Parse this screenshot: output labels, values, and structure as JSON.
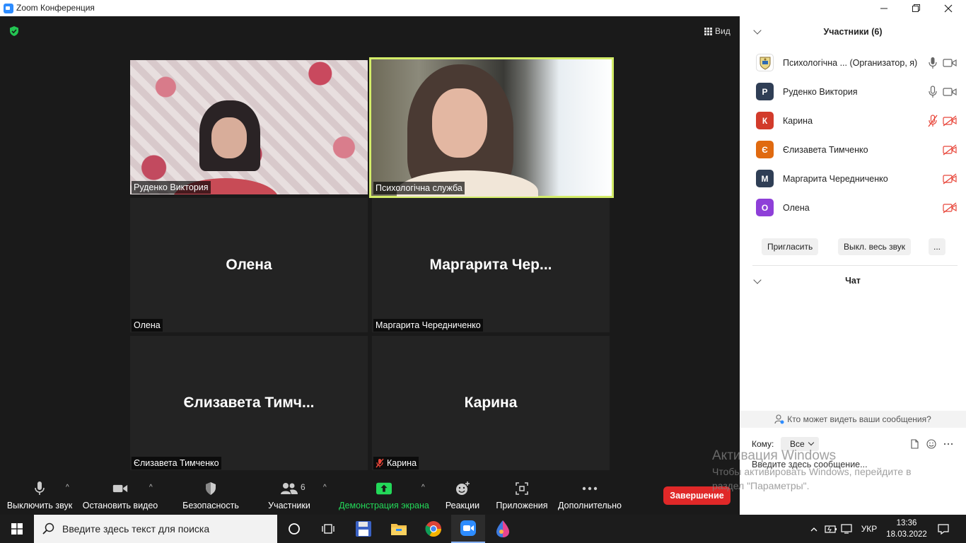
{
  "window": {
    "title": "Zoom Конференция"
  },
  "main": {
    "view_label": "Вид"
  },
  "tiles": [
    {
      "id": "rudenko",
      "center_name": "",
      "label": "Руденко  Виктория",
      "muted": false,
      "video": true
    },
    {
      "id": "psych",
      "center_name": "",
      "label": "Психологічна служба",
      "muted": false,
      "video": true,
      "active": true
    },
    {
      "id": "olena",
      "center_name": "Олена",
      "label": "Олена",
      "muted": false,
      "video": false
    },
    {
      "id": "margarita",
      "center_name": "Маргарита  Чер...",
      "label": "Маргарита Чередниченко",
      "muted": false,
      "video": false
    },
    {
      "id": "yelyzaveta",
      "center_name": "Єлизавета  Тимч...",
      "label": "Єлизавета Тимченко",
      "muted": false,
      "video": false
    },
    {
      "id": "karyna",
      "center_name": "Карина",
      "label": "Карина",
      "muted": true,
      "video": false
    }
  ],
  "toolbar": {
    "mute_label": "Выключить звук",
    "video_label": "Остановить видео",
    "security_label": "Безопасность",
    "participants_label": "Участники",
    "participants_count": "6",
    "share_label": "Демонстрация экрана",
    "reactions_label": "Реакции",
    "apps_label": "Приложения",
    "more_label": "Дополнительно",
    "end_label": "Завершение",
    "share_color": "#23d959",
    "end_color": "#e02828"
  },
  "participants_panel": {
    "title": "Участники (6)",
    "items": [
      {
        "name": "Психологічна ...  (Организатор, я)",
        "initial": "",
        "color": "#ffffff",
        "mic": "on",
        "cam": "on"
      },
      {
        "name": "Руденко  Виктория",
        "initial": "Р",
        "color": "#2f3e55",
        "mic": "on",
        "cam": "on"
      },
      {
        "name": "Карина",
        "initial": "К",
        "color": "#d23b2b",
        "mic": "off",
        "cam": "off"
      },
      {
        "name": "Єлизавета Тимченко",
        "initial": "Є",
        "color": "#e06a10",
        "mic": "none",
        "cam": "off"
      },
      {
        "name": "Маргарита Чередниченко",
        "initial": "М",
        "color": "#2f3e55",
        "mic": "none",
        "cam": "off"
      },
      {
        "name": "Олена",
        "initial": "О",
        "color": "#8e3fd8",
        "mic": "none",
        "cam": "off"
      }
    ],
    "invite_label": "Пригласить",
    "mute_all_label": "Выкл. весь звук",
    "more_label": "..."
  },
  "chat": {
    "title": "Чат",
    "who_can_see": "Кто может видеть ваши сообщения?",
    "to_label": "Кому:",
    "to_value": "Все",
    "placeholder": "Введите здесь сообщение..."
  },
  "watermark": {
    "title": "Активация Windows",
    "subtitle": "Чтобы активировать Windows, перейдите в раздел \"Параметры\"."
  },
  "taskbar": {
    "search_placeholder": "Введите здесь текст для поиска",
    "language": "УКР",
    "time": "13:36",
    "date": "18.03.2022"
  }
}
